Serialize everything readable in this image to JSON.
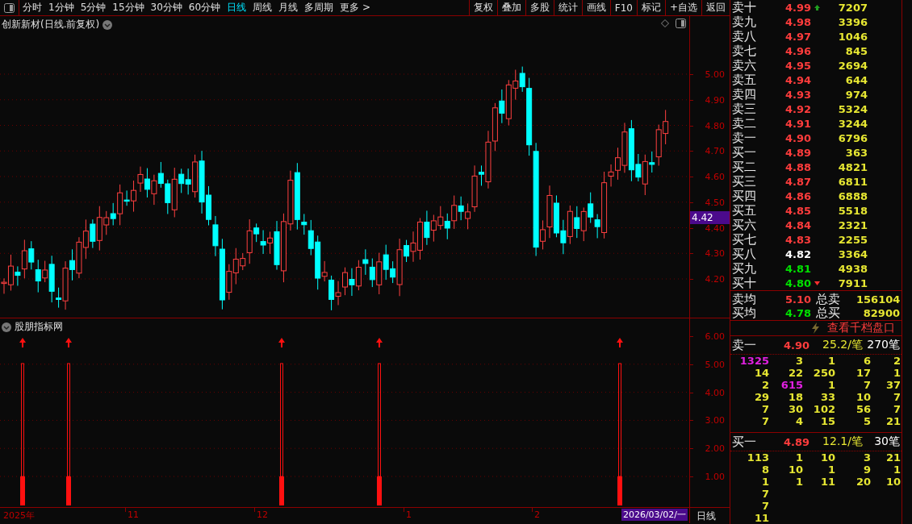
{
  "toolbar": {
    "periods": [
      {
        "label": "分时",
        "selected": false
      },
      {
        "label": "1分钟",
        "selected": false
      },
      {
        "label": "5分钟",
        "selected": false
      },
      {
        "label": "15分钟",
        "selected": false
      },
      {
        "label": "30分钟",
        "selected": false
      },
      {
        "label": "60分钟",
        "selected": false
      },
      {
        "label": "日线",
        "selected": true
      },
      {
        "label": "周线",
        "selected": false
      },
      {
        "label": "月线",
        "selected": false
      },
      {
        "label": "多周期",
        "selected": false
      },
      {
        "label": "更多 >",
        "selected": false
      }
    ],
    "buttons": [
      "复权",
      "叠加",
      "多股",
      "统计",
      "画线",
      "F10",
      "标记",
      "+自选",
      "返回"
    ]
  },
  "main_chart": {
    "title": "创新新材(日线.前复权)",
    "price_ticks": [
      "5.00",
      "4.90",
      "4.80",
      "4.70",
      "4.60",
      "4.50",
      "4.40",
      "4.30",
      "4.20"
    ],
    "current_price": "4.42"
  },
  "indicator": {
    "title": "股朋指标网",
    "ticks": [
      "6.00",
      "5.00",
      "4.00",
      "3.00",
      "2.00",
      "1.00"
    ]
  },
  "time_axis": {
    "labels": [
      "2025年",
      "11",
      "12",
      "1",
      "2"
    ],
    "cursor_date": "2026/03/02/一",
    "period": "日线"
  },
  "order_book": {
    "asks": [
      {
        "kind": "up",
        "label": "卖十",
        "price": "4.99",
        "volume": "7207",
        "color": "#ff3c3c"
      },
      {
        "kind": "plain",
        "label": "卖九",
        "price": "4.98",
        "volume": "3396",
        "color": "#ff3c3c"
      },
      {
        "kind": "plain",
        "label": "卖八",
        "price": "4.97",
        "volume": "1046",
        "color": "#ff3c3c"
      },
      {
        "kind": "plain",
        "label": "卖七",
        "price": "4.96",
        "volume": "845",
        "color": "#ff3c3c"
      },
      {
        "kind": "plain",
        "label": "卖六",
        "price": "4.95",
        "volume": "2694",
        "color": "#ff3c3c"
      },
      {
        "kind": "plain",
        "label": "卖五",
        "price": "4.94",
        "volume": "644",
        "color": "#ff3c3c"
      },
      {
        "kind": "plain",
        "label": "卖四",
        "price": "4.93",
        "volume": "974",
        "color": "#ff3c3c"
      },
      {
        "kind": "plain",
        "label": "卖三",
        "price": "4.92",
        "volume": "5324",
        "color": "#ff3c3c"
      },
      {
        "kind": "plain",
        "label": "卖二",
        "price": "4.91",
        "volume": "3244",
        "color": "#ff3c3c"
      },
      {
        "kind": "plain",
        "label": "卖一",
        "price": "4.90",
        "volume": "6796",
        "color": "#ff3c3c"
      }
    ],
    "bids": [
      {
        "kind": "plain",
        "label": "买一",
        "price": "4.89",
        "volume": "363",
        "color": "#ff3c3c"
      },
      {
        "kind": "plain",
        "label": "买二",
        "price": "4.88",
        "volume": "4821",
        "color": "#ff3c3c"
      },
      {
        "kind": "plain",
        "label": "买三",
        "price": "4.87",
        "volume": "6811",
        "color": "#ff3c3c"
      },
      {
        "kind": "plain",
        "label": "买四",
        "price": "4.86",
        "volume": "6888",
        "color": "#ff3c3c"
      },
      {
        "kind": "plain",
        "label": "买五",
        "price": "4.85",
        "volume": "5518",
        "color": "#ff3c3c"
      },
      {
        "kind": "plain",
        "label": "买六",
        "price": "4.84",
        "volume": "2321",
        "color": "#ff3c3c"
      },
      {
        "kind": "plain",
        "label": "买七",
        "price": "4.83",
        "volume": "2255",
        "color": "#ff3c3c"
      },
      {
        "kind": "plain",
        "label": "买八",
        "price": "4.82",
        "volume": "3364",
        "color": "#ffffff"
      },
      {
        "kind": "plain",
        "label": "买九",
        "price": "4.81",
        "volume": "4938",
        "color": "#00e000"
      },
      {
        "kind": "down",
        "label": "买十",
        "price": "4.80",
        "volume": "7911",
        "color": "#00e000"
      }
    ],
    "totals": [
      {
        "label": "卖均",
        "price": "5.10",
        "total_label": "总卖",
        "total": "156104",
        "color": "#ff3c3c"
      },
      {
        "label": "买均",
        "price": "4.78",
        "total_label": "总买",
        "total": "82900",
        "color": "#00e000"
      }
    ],
    "depth_link": "查看千档盘口"
  },
  "queues": [
    {
      "label": "卖一",
      "price": "4.90",
      "avg": "25.2/笔",
      "count": "270笔",
      "rows": [
        [
          {
            "v": "1325",
            "big": true
          },
          {
            "v": "3",
            "big": false
          },
          {
            "v": "1",
            "big": false
          },
          {
            "v": "6",
            "big": false
          },
          {
            "v": "2",
            "big": false
          }
        ],
        [
          {
            "v": "14",
            "big": false
          },
          {
            "v": "22",
            "big": false
          },
          {
            "v": "250",
            "big": false
          },
          {
            "v": "17",
            "big": false
          },
          {
            "v": "1",
            "big": false
          }
        ],
        [
          {
            "v": "2",
            "big": false
          },
          {
            "v": "615",
            "big": true
          },
          {
            "v": "1",
            "big": false
          },
          {
            "v": "7",
            "big": false
          },
          {
            "v": "37",
            "big": false
          }
        ],
        [
          {
            "v": "29",
            "big": false
          },
          {
            "v": "18",
            "big": false
          },
          {
            "v": "33",
            "big": false
          },
          {
            "v": "10",
            "big": false
          },
          {
            "v": "7",
            "big": false
          }
        ],
        [
          {
            "v": "7",
            "big": false
          },
          {
            "v": "30",
            "big": false
          },
          {
            "v": "102",
            "big": false
          },
          {
            "v": "56",
            "big": false
          },
          {
            "v": "7",
            "big": false
          }
        ],
        [
          {
            "v": "7",
            "big": false
          },
          {
            "v": "4",
            "big": false
          },
          {
            "v": "15",
            "big": false
          },
          {
            "v": "5",
            "big": false
          },
          {
            "v": "21",
            "big": false
          }
        ]
      ]
    },
    {
      "label": "买一",
      "price": "4.89",
      "avg": "12.1/笔",
      "count": "30笔",
      "rows": [
        [
          {
            "v": "113",
            "big": false
          },
          {
            "v": "1",
            "big": false
          },
          {
            "v": "10",
            "big": false
          },
          {
            "v": "3",
            "big": false
          },
          {
            "v": "21",
            "big": false
          }
        ],
        [
          {
            "v": "8",
            "big": false
          },
          {
            "v": "10",
            "big": false
          },
          {
            "v": "1",
            "big": false
          },
          {
            "v": "9",
            "big": false
          },
          {
            "v": "1",
            "big": false
          }
        ],
        [
          {
            "v": "1",
            "big": false
          },
          {
            "v": "1",
            "big": false
          },
          {
            "v": "11",
            "big": false
          },
          {
            "v": "20",
            "big": false
          },
          {
            "v": "10",
            "big": false
          }
        ],
        [
          {
            "v": "7",
            "big": false
          }
        ],
        [
          {
            "v": "7",
            "big": false
          }
        ],
        [
          {
            "v": "11",
            "big": false
          }
        ]
      ]
    }
  ]
}
